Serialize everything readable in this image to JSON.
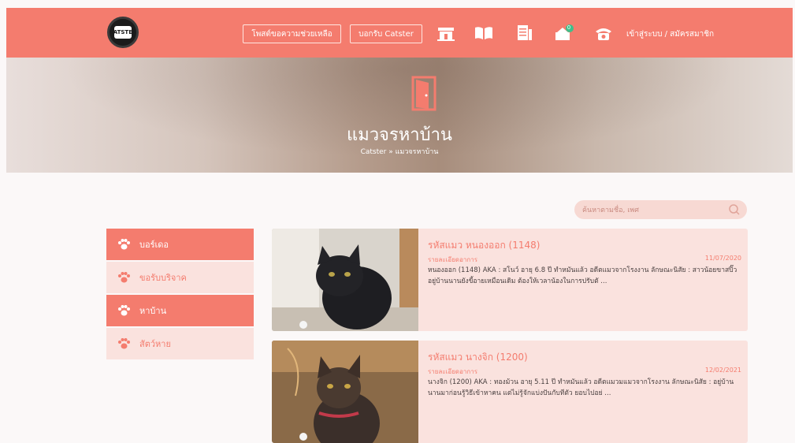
{
  "header": {
    "logo_text": "CATSTER",
    "nav_buttons": [
      "โพสต์ขอความช่วยเหลือ",
      "บอกรับ Catster"
    ],
    "icons": [
      "house-icon",
      "book-icon",
      "document-icon",
      "donation-icon",
      "phone-icon"
    ],
    "notification_count": "0",
    "login_label": "เข้าสู่ระบบ / สมัครสมาชิก"
  },
  "hero": {
    "title": "แมวจรหาบ้าน",
    "breadcrumb": "Catster  »  แมวจรหาบ้าน"
  },
  "search": {
    "placeholder": "ค้นหาตามชื่อ, เพศ"
  },
  "sidebar": {
    "items": [
      {
        "label": "บอร์เดอ",
        "active": true
      },
      {
        "label": "ขอรับบริจาค",
        "active": false
      },
      {
        "label": "หาบ้าน",
        "active": true
      },
      {
        "label": "สัตว์หาย",
        "active": false
      }
    ]
  },
  "cards": [
    {
      "title": "รหัสแมว หนองออก (1148)",
      "subtitle": "รายละเอียดอาการ",
      "date": "11/07/2020",
      "description": "หนองออก (1148) AKA : สโนว์ อายุ 6.8 ปี ทำหมันแล้ว อดีตแมวจากโรงงาน ลักษณะนิสัย : สาวน้อยขาสปิ๊ว อยู่บ้านนานยังขี้อายเหมือนเดิม ต้องให้เวลาน้องในการปรับตั ..."
    },
    {
      "title": "รหัสแมว นางจิก (1200)",
      "subtitle": "รายละเอียดอาการ",
      "date": "12/02/2021",
      "description": "นางจิก (1200) AKA : ทองม้วน อายุ 5.11 ปี ทำหมันแล้ว อดีตแมวมแมวจากโรงงาน ลักษณะนิสัย : อยู่บ้านนานมาก่อนรู้วิธีเข้าหาคน แต่ไม่รู้จักแบ่งปันกับทีตัว ยอบไปอย่ ..."
    }
  ],
  "colors": {
    "accent": "#f47c6e",
    "accent_light": "#fae2de"
  }
}
